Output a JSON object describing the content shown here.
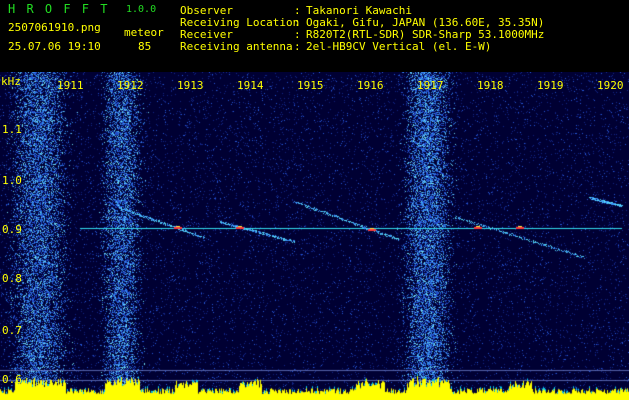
{
  "app": {
    "name": "H R O F F T",
    "version": "1.0.0"
  },
  "file": {
    "name": "2507061910.png",
    "datetime": "25.07.06 19:10"
  },
  "detection": {
    "label": "meteor",
    "count": "85"
  },
  "info": [
    {
      "key": "Observer",
      "sep": ":",
      "value": "Takanori Kawachi"
    },
    {
      "key": "Receiving Location",
      "sep": ":",
      "value": "Ogaki, Gifu, JAPAN (136.60E, 35.35N)"
    },
    {
      "key": "Receiver",
      "sep": ":",
      "value": "R820T2(RTL-SDR) SDR-Sharp 53.1000MHz"
    },
    {
      "key": "Receiving antenna",
      "sep": ":",
      "value": "2el-HB9CV Vertical (el. E-W)"
    }
  ],
  "axis": {
    "y_unit": "kHz",
    "y_labels": [
      "1.1",
      "1.0",
      "0.9",
      "0.8",
      "0.7",
      "0.6"
    ],
    "x_labels": [
      "1911",
      "1912",
      "1913",
      "1914",
      "1915",
      "1916",
      "1917",
      "1918",
      "1919",
      "1920"
    ]
  },
  "colors": {
    "label": "#ffff00",
    "title": "#22dd22",
    "background": "#00002a",
    "carrier_line": "#33ddee"
  }
}
